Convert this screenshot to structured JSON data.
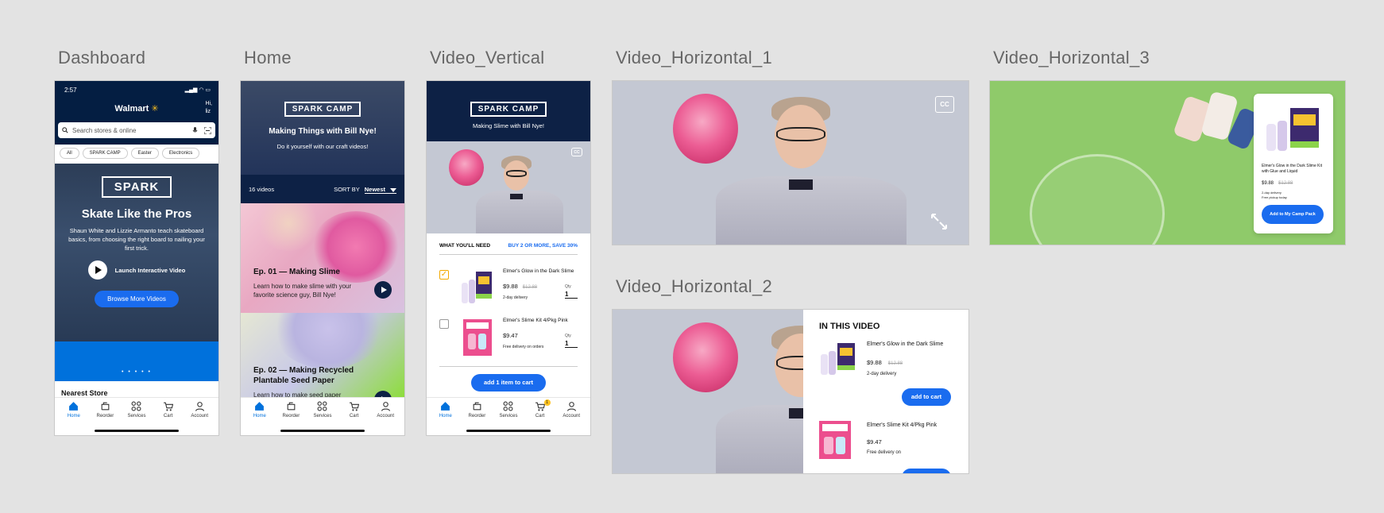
{
  "frames": {
    "dashboard": "Dashboard",
    "home": "Home",
    "video_vertical": "Video_Vertical",
    "video_horizontal_1": "Video_Horizontal_1",
    "video_horizontal_3": "Video_Horizontal_3",
    "video_horizontal_2": "Video_Horizontal_2"
  },
  "tabbar": [
    "Home",
    "Reorder",
    "Services",
    "Cart",
    "Account"
  ],
  "cart_badge": "1",
  "dashboard": {
    "time": "2:57",
    "brand": "Walmart",
    "greeting_line1": "Hi,",
    "greeting_line2": "liz",
    "search_placeholder": "Search stores & online",
    "chips": [
      "All",
      "SPARK CAMP",
      "Easter",
      "Electronics"
    ],
    "hero_logo": "SPARK",
    "hero_title": "Skate Like the Pros",
    "hero_desc": "Shaun White and Lizzie Armanto teach skateboard basics, from choosing the right board to nailing your first trick.",
    "launch_label": "Launch Interactive Video",
    "browse_label": "Browse More Videos",
    "dots": "• • • • •",
    "nearest_store": "Nearest Store"
  },
  "home": {
    "logo": "SPARK CAMP",
    "title": "Making Things with Bill Nye!",
    "subtitle": "Do it yourself with our craft videos!",
    "video_count": "16 videos",
    "sort_by": "SORT BY",
    "sort_value": "Newest",
    "episodes": [
      {
        "title": "Ep. 01 — Making Slime",
        "desc": "Learn how to make slime with your favorite science guy, Bill Nye!"
      },
      {
        "title": "Ep. 02 — Making Recycled Plantable Seed Paper",
        "desc": "Learn how to make seed paper"
      }
    ]
  },
  "video_vertical": {
    "logo": "SPARK CAMP",
    "subtitle": "Making Slime with Bill Nye!",
    "cc": "CC",
    "need_title": "WHAT YOU'LL NEED",
    "promo": "BUY 2 OR MORE, SAVE 30%",
    "products": [
      {
        "name": "Elmer's Glow in the Dark Slime",
        "price": "$9.88",
        "was": "$12.88",
        "ship": "2-day delivery",
        "qty_label": "Qty",
        "qty": "1",
        "checked": true
      },
      {
        "name": "Elmer's Slime Kit 4/Pkg Pink",
        "price": "$9.47",
        "was": "",
        "ship": "Free delivery on orders",
        "qty_label": "Qty",
        "qty": "1",
        "checked": false
      }
    ],
    "add_button": "add 1 item to cart"
  },
  "video_horizontal_1": {
    "cc": "CC"
  },
  "video_horizontal_3": {
    "product_name": "Elmer's Glow in the Dark Slime Kit with Glue and Liquid",
    "price": "$9.88",
    "was": "$12.88",
    "ship1": "2-day delivery",
    "ship2": "Free pickup today",
    "button": "Add to My Camp Pack"
  },
  "video_horizontal_2": {
    "heading": "IN THIS VIDEO",
    "products": [
      {
        "name": "Elmer's Glow in the Dark Slime",
        "price": "$9.88",
        "was": "$12.88",
        "ship": "2-day delivery"
      },
      {
        "name": "Elmer's Slime Kit 4/Pkg Pink",
        "price": "$9.47",
        "was": "",
        "ship": "Free delivery on"
      }
    ],
    "add_button": "add to cart"
  },
  "colors": {
    "navy": "#041e42",
    "walmart_blue": "#0071dc",
    "button_blue": "#1a6cef",
    "spark_yellow": "#ffc220",
    "video_bg": "#c4c8d3",
    "green_screen": "#8fca6a"
  }
}
